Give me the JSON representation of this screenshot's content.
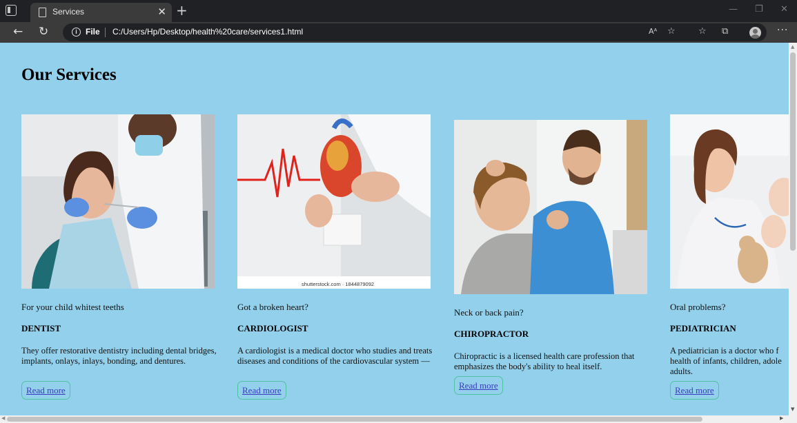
{
  "browser": {
    "tab_title": "Services",
    "file_label": "File",
    "url": "C:/Users/Hp/Desktop/health%20care/services1.html"
  },
  "page": {
    "title": "Our Services",
    "background": "#92d0eb",
    "link_border_color": "#4fc3a1",
    "link_color": "#3b3bbf"
  },
  "services": [
    {
      "subtitle": "For your child whitest teeths",
      "name": "DENTIST",
      "description": "They offer restorative dentistry including dental bridges, implants, onlays, inlays, bonding, and dentures.",
      "link": "Read more"
    },
    {
      "subtitle": "Got a broken heart?",
      "name": "CARDIOLOGIST",
      "description": "A cardiologist is a medical doctor who studies and treats diseases and conditions of the cardiovascular system —",
      "link": "Read more",
      "image_caption": "shutterstock.com · 1844879092"
    },
    {
      "subtitle": "Neck or back pain?",
      "name": "CHIROPRACTOR",
      "description": "Chiropractic is a licensed health care profession that emphasizes the body's ability to heal itself.",
      "link": "Read more"
    },
    {
      "subtitle": "Oral problems?",
      "name": "PEDIATRICIAN",
      "description": "A pediatrician is a doctor who f health of infants, children, adole adults.",
      "link": "Read more"
    }
  ]
}
